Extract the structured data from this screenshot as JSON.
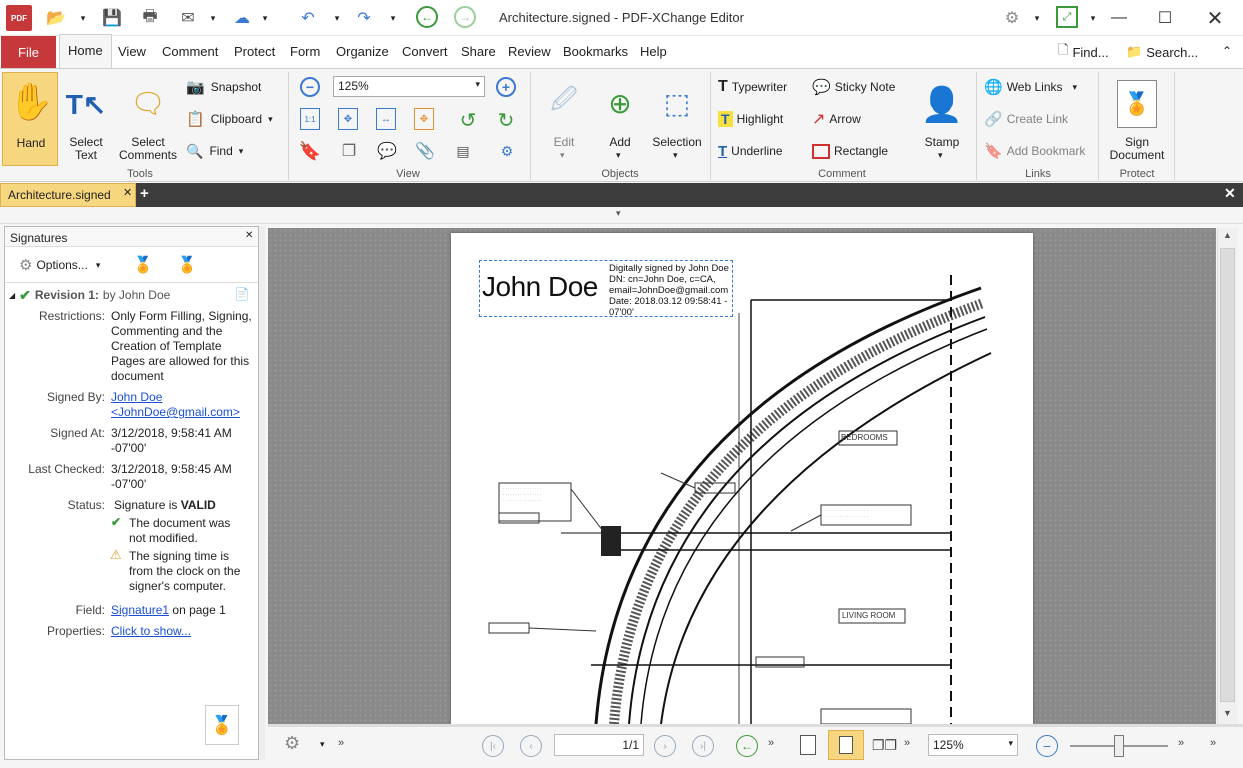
{
  "app": {
    "title": "Architecture.signed - PDF-XChange Editor",
    "logo_text": "PDF"
  },
  "menu": {
    "file": "File",
    "tabs": [
      "Home",
      "View",
      "Comment",
      "Protect",
      "Form",
      "Organize",
      "Convert",
      "Share",
      "Review",
      "Bookmarks",
      "Help"
    ],
    "find": "Find...",
    "search": "Search..."
  },
  "ribbon": {
    "tools": {
      "label": "Tools",
      "hand": "Hand",
      "select_text": "Select Text",
      "select_comments": "Select Comments",
      "snapshot": "Snapshot",
      "clipboard": "Clipboard",
      "find": "Find"
    },
    "view": {
      "label": "View",
      "zoom": "125%"
    },
    "objects": {
      "label": "Objects",
      "edit": "Edit",
      "add": "Add",
      "selection": "Selection"
    },
    "comment": {
      "label": "Comment",
      "typewriter": "Typewriter",
      "sticky_note": "Sticky Note",
      "highlight": "Highlight",
      "arrow": "Arrow",
      "underline": "Underline",
      "rectangle": "Rectangle",
      "stamp": "Stamp"
    },
    "links": {
      "label": "Links",
      "web_links": "Web Links",
      "create_link": "Create Link",
      "add_bookmark": "Add Bookmark"
    },
    "protect": {
      "label": "Protect",
      "sign_document": "Sign Document"
    }
  },
  "doc_tab": {
    "name": "Architecture.signed"
  },
  "signatures": {
    "panel_title": "Signatures",
    "options": "Options...",
    "revision_title": "Revision 1:",
    "revision_by": "by John Doe",
    "restrictions_label": "Restrictions:",
    "restrictions_value": "Only Form Filling, Signing, Commenting and the Creation of Template Pages are allowed for this document",
    "signed_by_label": "Signed By:",
    "signed_by_name": "John Doe",
    "signed_by_email": "<JohnDoe@gmail.com>",
    "signed_at_label": "Signed At:",
    "signed_at_value": "3/12/2018, 9:58:41 AM -07'00'",
    "last_checked_label": "Last Checked:",
    "last_checked_value": "3/12/2018, 9:58:45 AM -07'00'",
    "status_label": "Status:",
    "status_prefix": "Signature is",
    "status_value": "VALID",
    "status_item1": "The document was not modified.",
    "status_item2": "The signing time is from the clock on the signer's computer.",
    "field_label": "Field:",
    "field_link": "Signature1",
    "field_suffix": "on page 1",
    "properties_label": "Properties:",
    "properties_link": "Click to show..."
  },
  "document": {
    "signature_name": "John Doe",
    "sig_line1": "Digitally signed by John Doe",
    "sig_line2": "DN: cn=John Doe, c=CA,",
    "sig_line3": "email=JohnDoe@gmail.com",
    "sig_line4": "Date: 2018.03.12 09:58:41 -",
    "sig_line5": "07'00'",
    "room1": "BEDROOMS",
    "room2": "LIVING ROOM"
  },
  "statusbar": {
    "page": "1/1",
    "zoom": "125%"
  }
}
